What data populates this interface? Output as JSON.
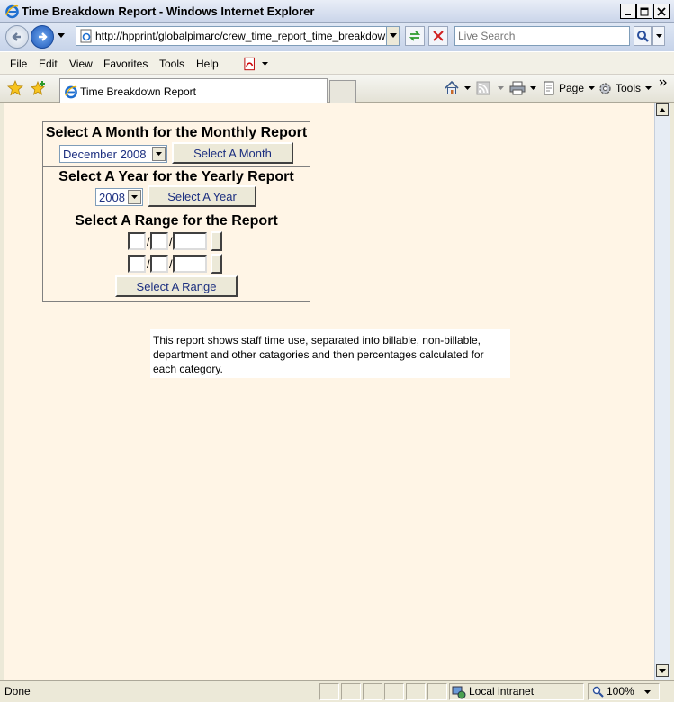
{
  "window": {
    "title": "Time Breakdown Report - Windows Internet Explorer"
  },
  "addressbar": {
    "url": "http://hpprint/globalpimarc/crew_time_report_time_breakdown.asp",
    "search_placeholder": "Live Search"
  },
  "menu": {
    "items": [
      "File",
      "Edit",
      "View",
      "Favorites",
      "Tools",
      "Help"
    ]
  },
  "tab": {
    "label": "Time Breakdown Report"
  },
  "commandbar": {
    "page_label": "Page",
    "tools_label": "Tools"
  },
  "report": {
    "monthly": {
      "heading": "Select A Month for the Monthly Report",
      "selected_month": "December 2008",
      "button": "Select A Month"
    },
    "yearly": {
      "heading": "Select A Year for the Yearly Report",
      "selected_year": "2008",
      "button": "Select A Year"
    },
    "range": {
      "heading": "Select A Range for the Report",
      "separator": "/",
      "button": "Select A Range"
    }
  },
  "description": "This report shows staff time use, separated into billable, non-billable, department and other catagories and then percentages calculated for each category.",
  "statusbar": {
    "status": "Done",
    "zone": "Local intranet",
    "zoom": "100%"
  },
  "colors": {
    "content_bg": "#fff5e6",
    "button_text": "#1c2f80"
  }
}
